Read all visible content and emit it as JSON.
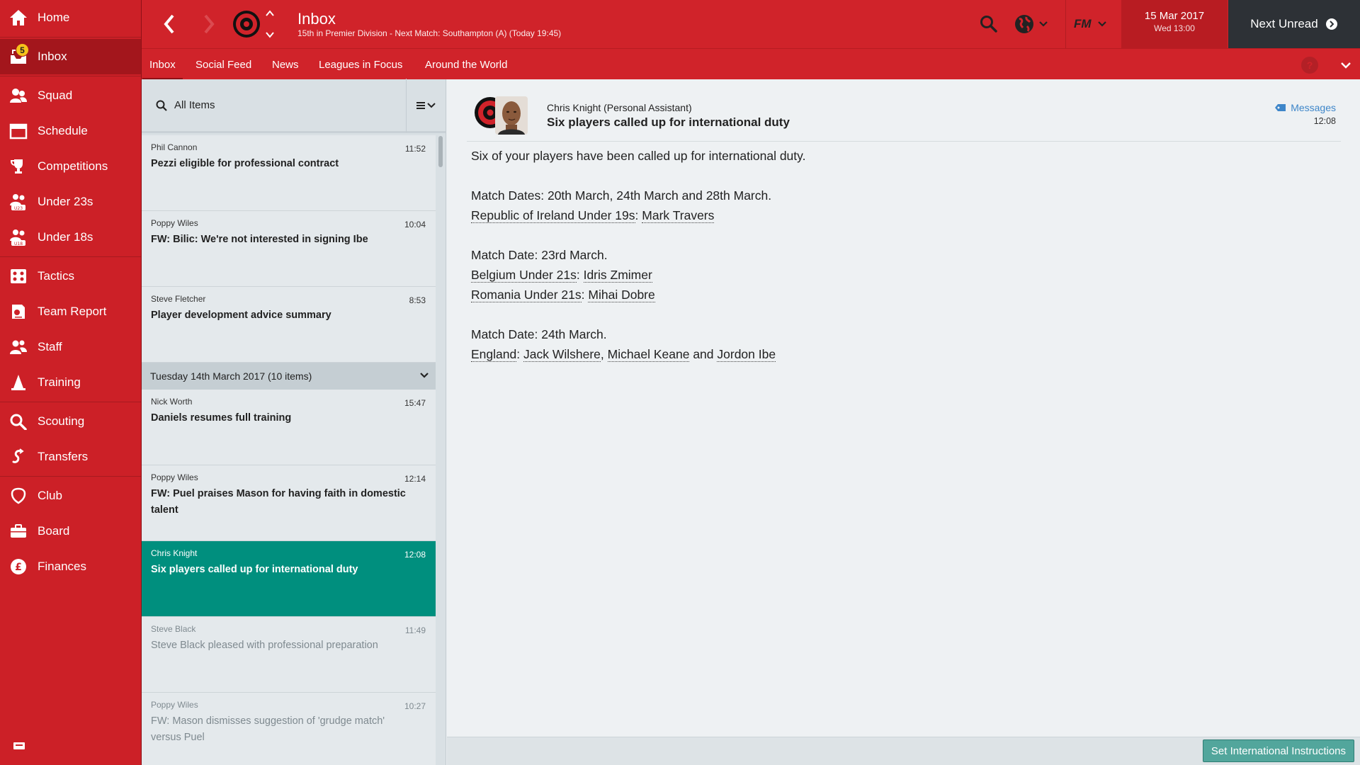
{
  "colors": {
    "accent_red": "#d0232a",
    "sidebar_red": "#cc2027",
    "selected_teal": "#008f7e",
    "dark_button": "#2d3136",
    "link_blue": "#3e86c9"
  },
  "sidebar": {
    "items": [
      {
        "label": "Home",
        "icon": "home-icon"
      },
      {
        "label": "Inbox",
        "icon": "inbox-icon",
        "badge": "5",
        "active": true
      },
      {
        "label": "Squad",
        "icon": "squad-icon"
      },
      {
        "label": "Schedule",
        "icon": "calendar-icon"
      },
      {
        "label": "Competitions",
        "icon": "trophy-icon"
      },
      {
        "label": "Under 23s",
        "icon": "under23-icon"
      },
      {
        "label": "Under 18s",
        "icon": "under18-icon"
      },
      {
        "label": "Tactics",
        "icon": "tactics-icon"
      },
      {
        "label": "Team Report",
        "icon": "team-report-icon"
      },
      {
        "label": "Staff",
        "icon": "staff-icon"
      },
      {
        "label": "Training",
        "icon": "training-cone-icon"
      },
      {
        "label": "Scouting",
        "icon": "search-icon"
      },
      {
        "label": "Transfers",
        "icon": "transfers-icon"
      },
      {
        "label": "Club",
        "icon": "shield-icon"
      },
      {
        "label": "Board",
        "icon": "briefcase-icon"
      },
      {
        "label": "Finances",
        "icon": "pound-icon"
      }
    ]
  },
  "header": {
    "title": "Inbox",
    "subtitle": "15th in Premier Division - Next Match: Southampton (A) (Today 19:45)",
    "fm_label": "FM",
    "date": "15 Mar 2017",
    "day_time": "Wed 13:00",
    "next_unread": "Next Unread"
  },
  "tabs": [
    {
      "label": "Inbox",
      "active": true
    },
    {
      "label": "Social Feed"
    },
    {
      "label": "News"
    },
    {
      "label": "Leagues in Focus"
    },
    {
      "label": "Around the World"
    }
  ],
  "help_label": "?",
  "list": {
    "filter_label": "All Items",
    "messages_top": [
      {
        "from": "Phil Cannon",
        "time": "11:52",
        "subject": "Pezzi eligible for professional contract"
      },
      {
        "from": "Poppy Wiles",
        "time": "10:04",
        "subject": "FW: Bilic: We're not interested in signing Ibe"
      },
      {
        "from": "Steve Fletcher",
        "time": "8:53",
        "subject": "Player development advice summary"
      }
    ],
    "group_label": "Tuesday 14th March 2017 (10 items)",
    "messages_group": [
      {
        "from": "Nick Worth",
        "time": "15:47",
        "subject": "Daniels resumes full training",
        "state": "unread"
      },
      {
        "from": "Poppy Wiles",
        "time": "12:14",
        "subject": "FW: Puel praises Mason for having faith in domestic talent",
        "state": "unread"
      },
      {
        "from": "Chris Knight",
        "time": "12:08",
        "subject": "Six players called up for international duty",
        "state": "selected"
      },
      {
        "from": "Steve Black",
        "time": "11:49",
        "subject": "Steve Black pleased with professional preparation",
        "state": "read"
      },
      {
        "from": "Poppy Wiles",
        "time": "10:27",
        "subject": "FW: Mason dismisses suggestion of 'grudge match' versus Puel",
        "state": "read"
      }
    ]
  },
  "detail": {
    "sender": "Chris Knight  (Personal Assistant)",
    "subject": "Six players called up for international duty",
    "category": "Messages",
    "time": "12:08",
    "intro": "Six of your players have been called up for international duty.",
    "block1": {
      "heading": "Match Dates: 20th March, 24th March and 28th March.",
      "team1": "Republic of Ireland Under 19s",
      "player1": "Mark Travers"
    },
    "block2": {
      "heading": "Match Date: 23rd March.",
      "team1": "Belgium Under 21s",
      "player1": "Idris Zmimer",
      "team2": "Romania Under 21s",
      "player2": "Mihai Dobre"
    },
    "block3": {
      "heading": "Match Date: 24th March.",
      "team1": "England",
      "player1": "Jack Wilshere",
      "player2": "Michael Keane",
      "and_word": "and",
      "player3": "Jordon Ibe"
    },
    "colon": ":",
    "comma": ","
  },
  "footer": {
    "button": "Set International Instructions"
  }
}
